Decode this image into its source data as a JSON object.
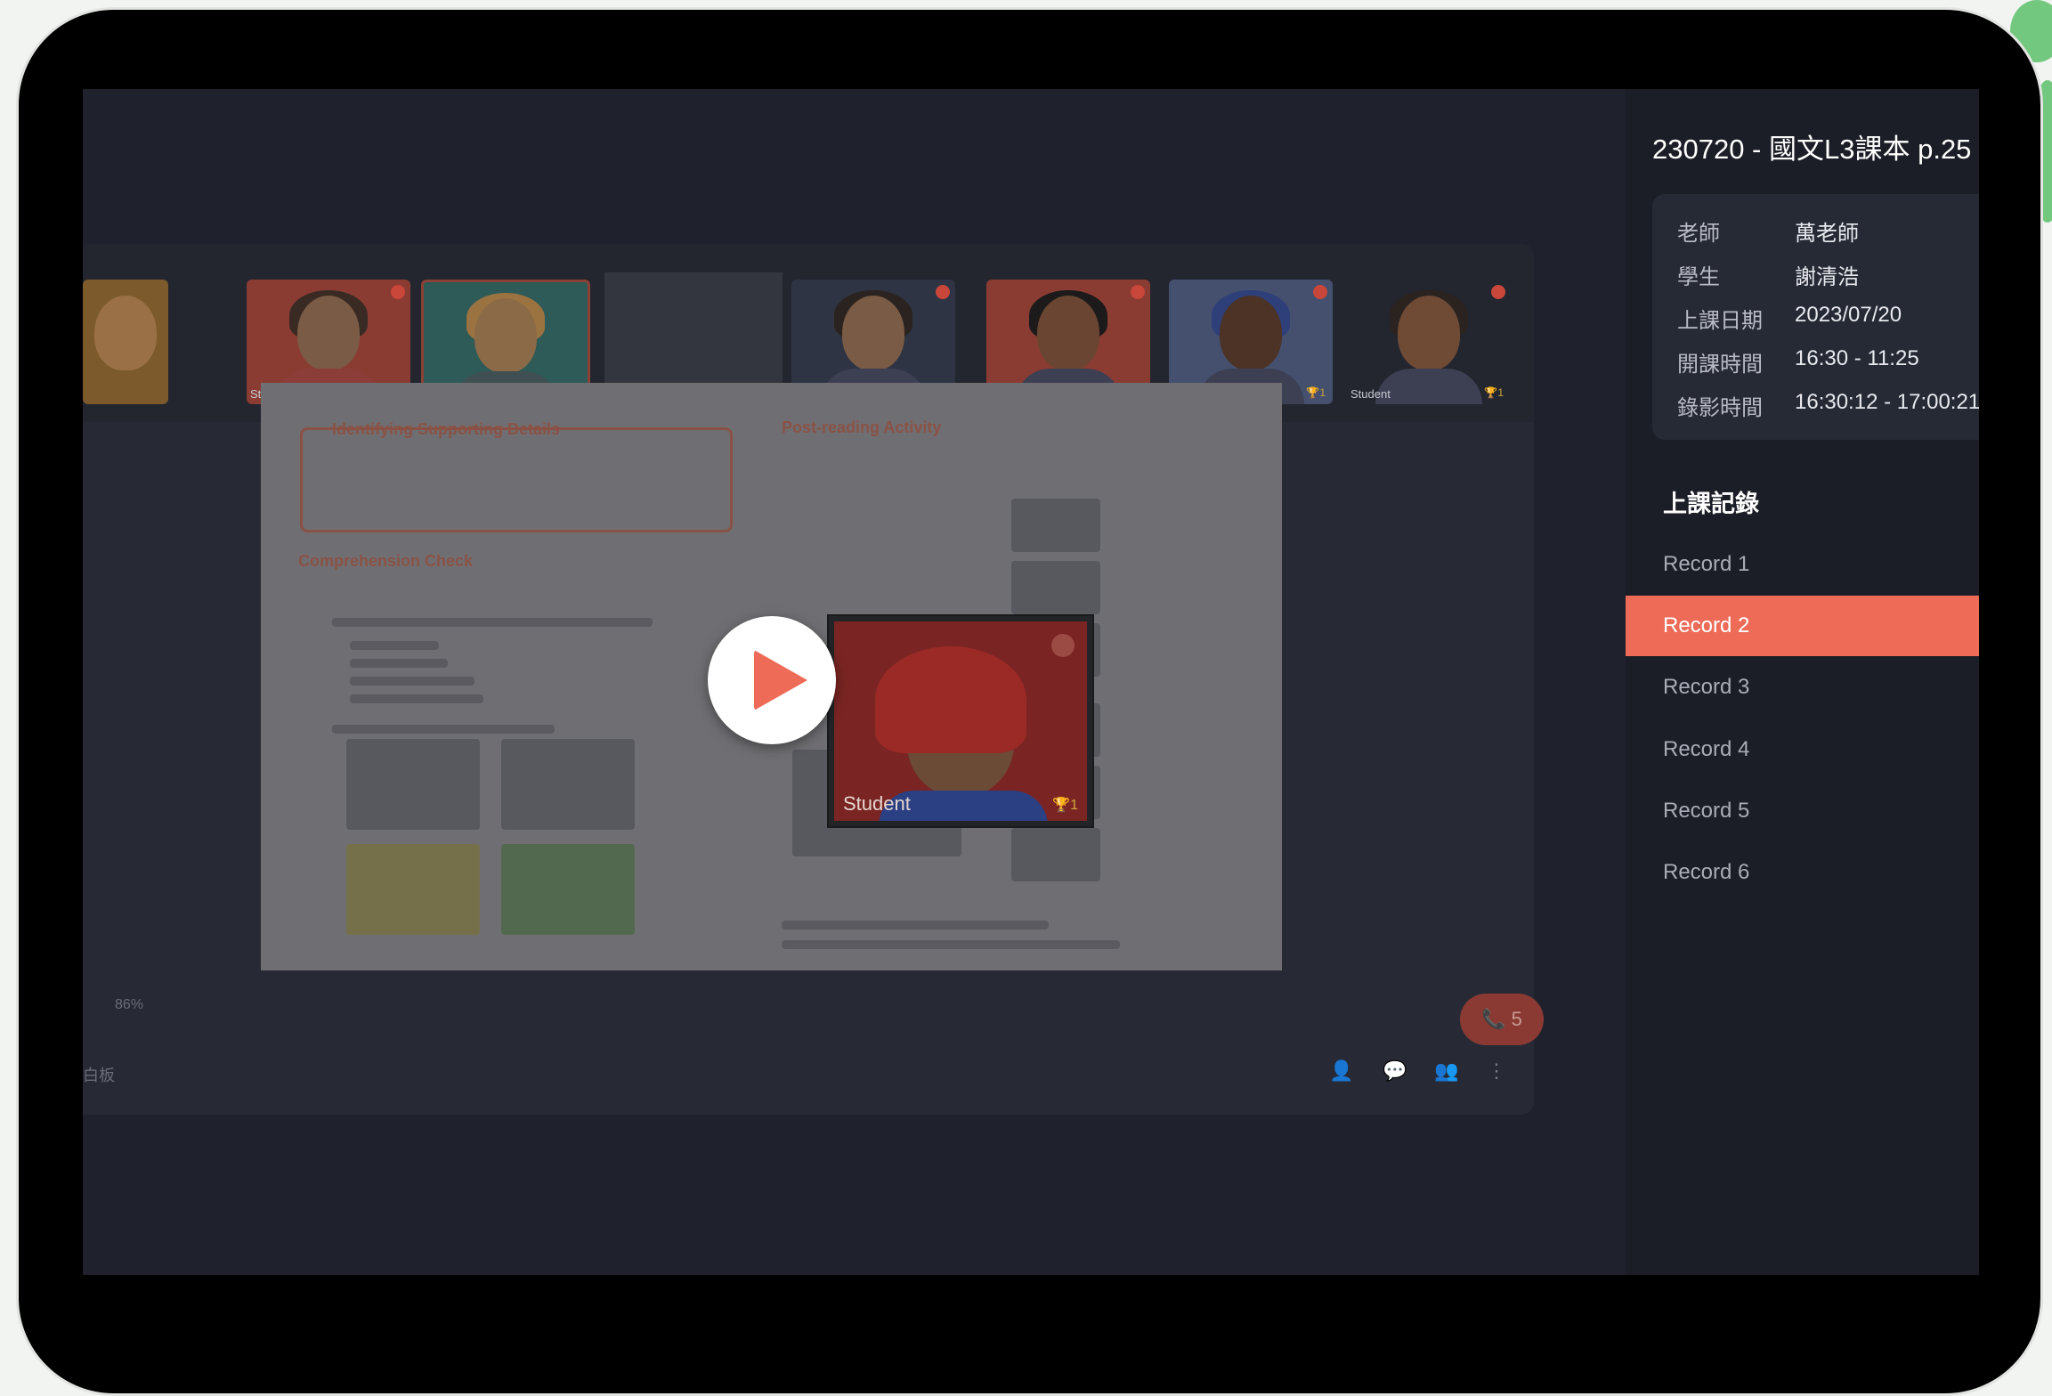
{
  "session_title": "230720 - 國文L3課本 p.25",
  "info": {
    "teacher_label": "老師",
    "teacher": "萬老師",
    "student_label": "學生",
    "student": "謝清浩",
    "date_label": "上課日期",
    "date": "2023/07/20",
    "class_time_label": "開課時間",
    "class_time": "16:30 - 11:25",
    "record_time_label": "錄影時間",
    "record_time": "16:30:12 - 17:00:21"
  },
  "records_heading": "上課記錄",
  "records": [
    "Record 1",
    "Record 2",
    "Record 3",
    "Record 4",
    "Record 5",
    "Record 6"
  ],
  "active_record": "Record 2",
  "video": {
    "participant_label": "Student",
    "tile_trophy": "🏆1",
    "overlay_trophy": "🏆1",
    "zoom": "86%",
    "tab_name": "白板",
    "call_count": "5"
  },
  "slide": {
    "left_heading": "Identifying Supporting Details",
    "comprehension": "Comprehension Check",
    "right_heading": "Post-reading Activity"
  },
  "colors": {
    "accent": "#ee6b58",
    "sidebar_bg": "#1b1e26",
    "player_bg": "#1f222c"
  }
}
